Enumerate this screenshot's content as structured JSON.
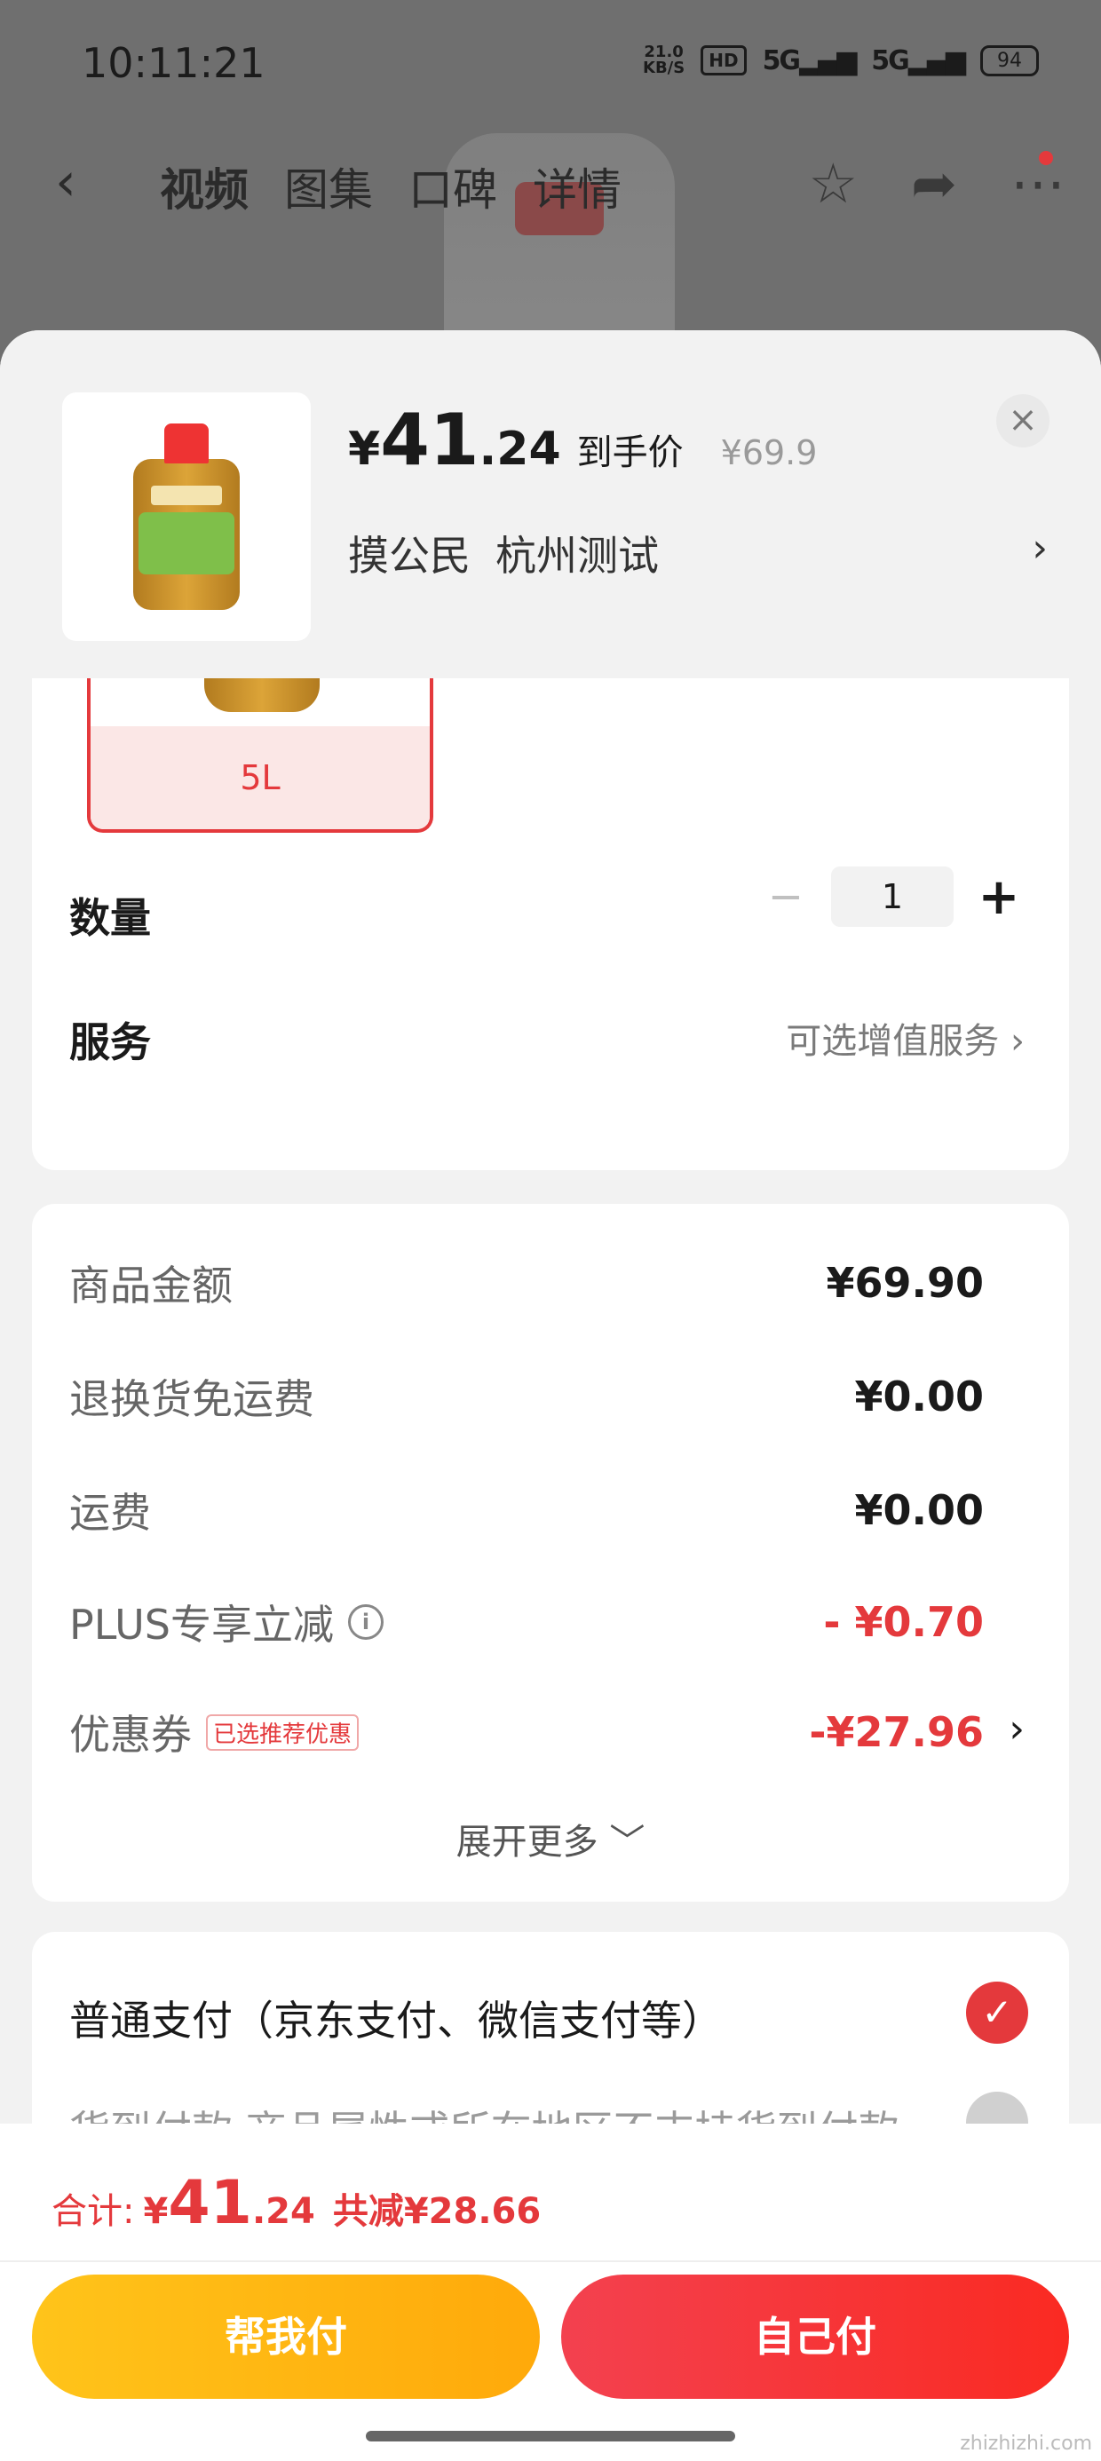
{
  "status_bar": {
    "time": "10:11:21",
    "net_speed": "21.0",
    "net_unit": "KB/S",
    "hd": "HD",
    "signal1": "5G",
    "signal2": "5G",
    "battery": "94"
  },
  "top_nav": {
    "tabs": [
      "视频",
      "图集",
      "口碑",
      "详情"
    ]
  },
  "sheet": {
    "price_currency": "¥",
    "price_int": "41",
    "price_dec": ".24",
    "price_tag": "到手价",
    "original_price": "¥69.9",
    "address_name": "摸公民",
    "address_city": "杭州测试",
    "close_glyph": "×"
  },
  "spec": {
    "sku_label": "5L",
    "quantity_label": "数量",
    "quantity_value": "1",
    "minus": "−",
    "plus": "+",
    "service_label": "服务",
    "service_value": "可选增值服务"
  },
  "amounts": {
    "rows": [
      {
        "label": "商品金额",
        "value": "¥69.90"
      },
      {
        "label": "退换货免运费",
        "value": "¥0.00"
      },
      {
        "label": "运费",
        "value": "¥0.00"
      },
      {
        "label": "PLUS专享立减",
        "value": "- ¥0.70"
      },
      {
        "label": "优惠券",
        "badge": "已选推荐优惠",
        "value": "-¥27.96"
      }
    ],
    "expand_more": "展开更多 ﹀"
  },
  "payment": {
    "option1": "普通支付（京东支付、微信支付等）",
    "option2": "货到付款 商品属性或所在地区不支持货到付款"
  },
  "footer": {
    "total_label": "合计:",
    "total_currency": "¥",
    "total_int": "41",
    "total_dec": ".24",
    "total_saving": "共减¥28.66",
    "help_pay": "帮我付",
    "self_pay": "自己付"
  },
  "colors": {
    "accent_red": "#e4393c",
    "help_yellow": "#ffb60f"
  },
  "watermark": "zhizhizhi.com"
}
